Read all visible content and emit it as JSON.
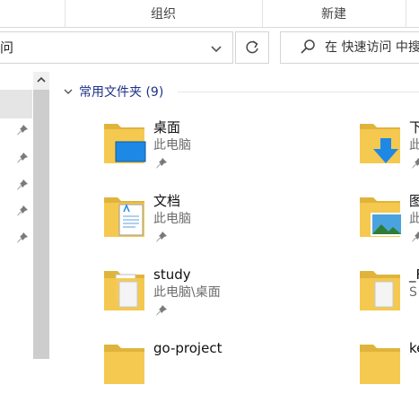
{
  "ribbon": {
    "group_organize": "组织",
    "group_new": "新建"
  },
  "address": {
    "path_fragment": "问"
  },
  "search": {
    "placeholder": "在 快速访问 中搜"
  },
  "quick_access": {
    "header": "常用文件夹 (9)",
    "folders": [
      {
        "name": "桌面",
        "location": "此电脑",
        "icon": "desktop-folder-icon",
        "pinned": true
      },
      {
        "name": "下",
        "location": "此",
        "icon": "downloads-folder-icon",
        "pinned": true
      },
      {
        "name": "文档",
        "location": "此电脑",
        "icon": "documents-folder-icon",
        "pinned": true
      },
      {
        "name": "图",
        "location": "此",
        "icon": "pictures-folder-icon",
        "pinned": true
      },
      {
        "name": "study",
        "location": "此电脑\\桌面",
        "icon": "folder-icon",
        "pinned": true
      },
      {
        "name": "_F",
        "location": "S",
        "icon": "folder-icon",
        "pinned": false
      },
      {
        "name": "go-project",
        "location": "",
        "icon": "folder-icon",
        "pinned": false
      },
      {
        "name": "ke",
        "location": "",
        "icon": "folder-icon",
        "pinned": false
      }
    ]
  },
  "colors": {
    "header_text": "#1e3287",
    "folder_yellow": "#f5c94f",
    "accent_blue": "#1e88e5"
  }
}
